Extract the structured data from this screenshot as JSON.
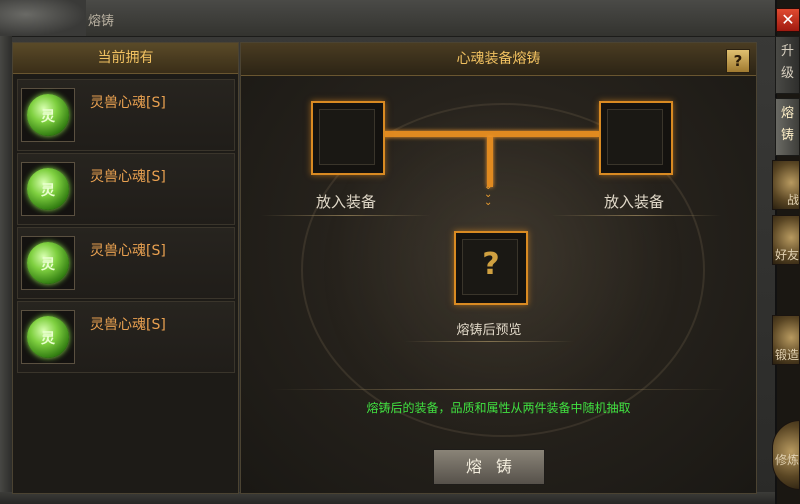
{
  "window": {
    "title": "熔铸"
  },
  "left_panel": {
    "header": "当前拥有",
    "items": [
      {
        "name": "灵兽心魂[S]",
        "icon_char": "灵"
      },
      {
        "name": "灵兽心魂[S]",
        "icon_char": "灵"
      },
      {
        "name": "灵兽心魂[S]",
        "icon_char": "灵"
      },
      {
        "name": "灵兽心魂[S]",
        "icon_char": "灵"
      }
    ]
  },
  "right_panel": {
    "header": "心魂装备熔铸",
    "help": "?",
    "slot_left_label": "放入装备",
    "slot_right_label": "放入装备",
    "preview_mark": "?",
    "preview_label": "熔铸后预览",
    "hint": "熔铸后的装备，品质和属性从两件装备中随机抽取",
    "forge_button": "熔铸"
  },
  "side_tabs": [
    {
      "label": "升级"
    },
    {
      "label": "熔铸"
    },
    {
      "label": "战"
    },
    {
      "label": "好友"
    },
    {
      "label": "锻造"
    },
    {
      "label": "修炼"
    }
  ],
  "close": "✕",
  "colors": {
    "accent_orange": "#e08a20",
    "header_gold": "#f0c060",
    "item_name": "#e8a050",
    "hint_green": "#40e040"
  }
}
